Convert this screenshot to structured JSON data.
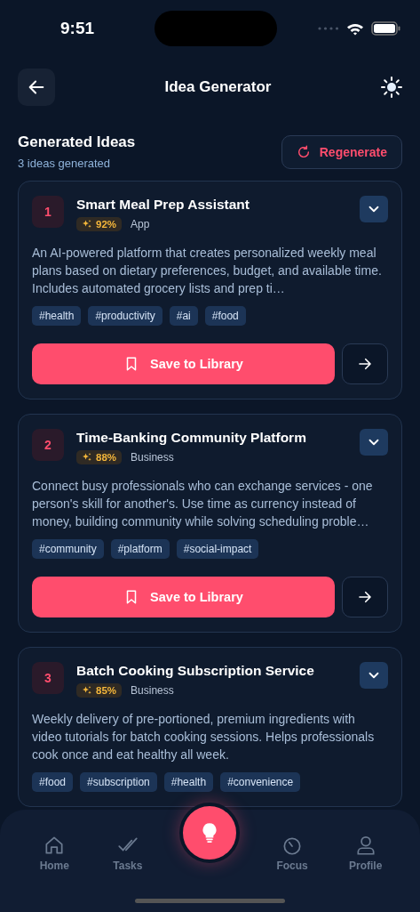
{
  "status_bar": {
    "time": "9:51"
  },
  "header": {
    "title": "Idea Generator"
  },
  "section": {
    "title": "Generated Ideas",
    "subtitle": "3 ideas generated",
    "action": "Regenerate"
  },
  "ideas": [
    {
      "number": "1",
      "title": "Smart Meal Prep Assistant",
      "score": "92%",
      "category": "App",
      "expanded": false,
      "description": "An AI-powered platform that creates personalized weekly meal plans based on dietary preferences, budget, and available time. Includes automated grocery lists and prep ti…",
      "tags": [
        "#health",
        "#productivity",
        "#ai",
        "#food"
      ],
      "save_label": "Save to Library"
    },
    {
      "number": "2",
      "title": "Time-Banking Community Platform",
      "score": "88%",
      "category": "Business",
      "expanded": false,
      "description": "Connect busy professionals who can exchange services - one person's skill for another's. Use time as currency instead of money, building community while solving scheduling proble…",
      "tags": [
        "#community",
        "#platform",
        "#social-impact"
      ],
      "save_label": "Save to Library"
    },
    {
      "number": "3",
      "title": "Batch Cooking Subscription Service",
      "score": "85%",
      "category": "Business",
      "expanded": false,
      "description": "Weekly delivery of pre-portioned, premium ingredients with video tutorials for batch cooking sessions. Helps professionals cook once and eat healthy all week.",
      "tags": [
        "#food",
        "#subscription",
        "#health",
        "#convenience"
      ]
    }
  ],
  "bottom_nav": {
    "items": [
      {
        "kind": "home",
        "label": "Home",
        "selected": false
      },
      {
        "kind": "tasks",
        "label": "Tasks",
        "selected": false
      },
      {
        "kind": "fab",
        "selected": true
      },
      {
        "kind": "focus",
        "label": "Focus",
        "selected": false
      },
      {
        "kind": "profile",
        "label": "Profile",
        "selected": false
      }
    ]
  }
}
